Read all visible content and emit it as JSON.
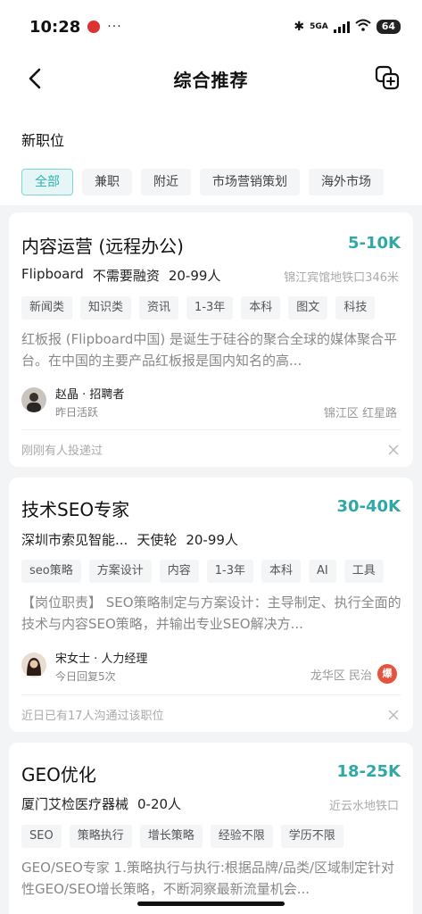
{
  "status_bar": {
    "time": "10:28",
    "dots": "···",
    "network": "5GA",
    "battery": "64"
  },
  "header": {
    "title": "综合推荐"
  },
  "section": {
    "title": "新职位",
    "filters": [
      "全部",
      "兼职",
      "附近",
      "市场营销策划",
      "海外市场"
    ]
  },
  "jobs": [
    {
      "title": "内容运营 (远程办公)",
      "salary": "5-10K",
      "company": "Flipboard",
      "funding": "不需要融资",
      "size": "20-99人",
      "location": "锦江宾馆地铁口346米",
      "tags": [
        "新闻类",
        "知识类",
        "资讯",
        "1-3年",
        "本科",
        "图文",
        "科技"
      ],
      "description": "红板报 (Flipboard中国) 是诞生于硅谷的聚合全球的媒体聚合平台。在中国的主要产品红板报是国内知名的高...",
      "recruiter_name": "赵晶 · 招聘者",
      "recruiter_status": "昨日活跃",
      "district": "锦江区 红星路",
      "footer": "刚刚有人投递过"
    },
    {
      "title": "技术SEO专家",
      "salary": "30-40K",
      "company": "深圳市索见智能...",
      "funding": "天使轮",
      "size": "20-99人",
      "tags": [
        "seo策略",
        "方案设计",
        "内容",
        "1-3年",
        "本科",
        "AI",
        "工具"
      ],
      "description": "【岗位职责】 SEO策略制定与方案设计：主导制定、执行全面的技术与内容SEO策略，并输出专业SEO解决方...",
      "recruiter_name": "宋女士 · 人力经理",
      "recruiter_status": "今日回复5次",
      "district": "龙华区 民治",
      "badge": "爆",
      "footer": "近日已有17人沟通过该职位"
    },
    {
      "title": "GEO优化",
      "salary": "18-25K",
      "company": "厦门艾检医疗器械",
      "size": "0-20人",
      "location": "近云水地铁口",
      "tags": [
        "SEO",
        "策略执行",
        "增长策略",
        "经验不限",
        "学历不限"
      ],
      "description": "GEO/SEO专家 1.策略执行与执行:根据品牌/品类/区域制定针对性GEO/SEO增长策略，不断洞察最新流量机会..."
    }
  ],
  "colors": {
    "accent": "#2fa8a6",
    "chip_active_bg": "#e6f6f6",
    "hot_badge": "#e5533c"
  }
}
